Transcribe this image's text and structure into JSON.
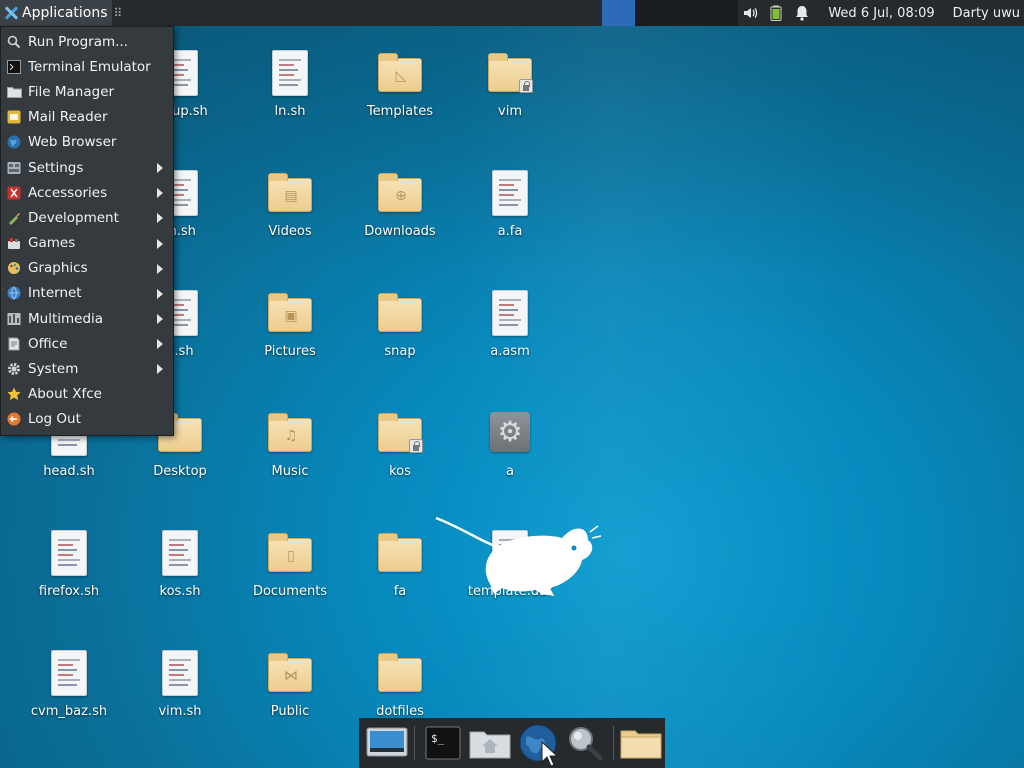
{
  "top_panel": {
    "applications_label": "Applications",
    "clock": "Wed  6 Jul, 08:09",
    "user": "Darty uwu",
    "workspaces": 4,
    "active_workspace": 1
  },
  "app_menu": {
    "items": [
      {
        "label": "Run Program...",
        "icon": "search-icon",
        "submenu": false
      },
      {
        "label": "Terminal Emulator",
        "icon": "terminal-icon",
        "submenu": false
      },
      {
        "label": "File Manager",
        "icon": "folder-icon",
        "submenu": false
      },
      {
        "label": "Mail Reader",
        "icon": "mail-icon",
        "submenu": false
      },
      {
        "label": "Web Browser",
        "icon": "globe-icon",
        "submenu": false
      },
      {
        "label": "Settings",
        "icon": "settings-icon",
        "submenu": true
      },
      {
        "label": "Accessories",
        "icon": "accessories-icon",
        "submenu": true
      },
      {
        "label": "Development",
        "icon": "development-icon",
        "submenu": true
      },
      {
        "label": "Games",
        "icon": "games-icon",
        "submenu": true
      },
      {
        "label": "Graphics",
        "icon": "graphics-icon",
        "submenu": true
      },
      {
        "label": "Internet",
        "icon": "internet-icon",
        "submenu": true
      },
      {
        "label": "Multimedia",
        "icon": "multimedia-icon",
        "submenu": true
      },
      {
        "label": "Office",
        "icon": "office-icon",
        "submenu": true
      },
      {
        "label": "System",
        "icon": "gear-icon",
        "submenu": true
      },
      {
        "label": "About Xfce",
        "icon": "star-icon",
        "submenu": false
      },
      {
        "label": "Log Out",
        "icon": "logout-icon",
        "submenu": false
      }
    ]
  },
  "desktop": {
    "icons": [
      {
        "label": "setup.sh",
        "type": "file"
      },
      {
        "label": "ln.sh",
        "type": "file"
      },
      {
        "label": "Templates",
        "type": "folder",
        "emblem": "template"
      },
      {
        "label": "vim",
        "type": "folder",
        "lock": true
      },
      {
        "label": "m.sh",
        "type": "file"
      },
      {
        "label": "Videos",
        "type": "folder",
        "emblem": "film"
      },
      {
        "label": "Downloads",
        "type": "folder",
        "emblem": "download"
      },
      {
        "label": "a.fa",
        "type": "file"
      },
      {
        "label": "e.sh",
        "type": "file"
      },
      {
        "label": "Pictures",
        "type": "folder",
        "emblem": "picture"
      },
      {
        "label": "snap",
        "type": "folder"
      },
      {
        "label": "a.asm",
        "type": "file"
      },
      {
        "label": "head.sh",
        "type": "file"
      },
      {
        "label": "Desktop",
        "type": "folder"
      },
      {
        "label": "Music",
        "type": "folder",
        "emblem": "music"
      },
      {
        "label": "kos",
        "type": "folder",
        "lock": true
      },
      {
        "label": "a",
        "type": "executable"
      },
      {
        "label": "firefox.sh",
        "type": "file"
      },
      {
        "label": "kos.sh",
        "type": "file"
      },
      {
        "label": "Documents",
        "type": "folder",
        "emblem": "document"
      },
      {
        "label": "fa",
        "type": "folder"
      },
      {
        "label": "template.dat",
        "type": "file"
      },
      {
        "label": "cvm_baz.sh",
        "type": "file"
      },
      {
        "label": "vim.sh",
        "type": "file"
      },
      {
        "label": "Public",
        "type": "folder",
        "emblem": "share"
      },
      {
        "label": "dotfiles",
        "type": "folder"
      }
    ]
  },
  "dock": {
    "items": [
      {
        "name": "show-desktop-icon"
      },
      {
        "name": "terminal-icon"
      },
      {
        "name": "home-folder-icon"
      },
      {
        "name": "web-browser-icon"
      },
      {
        "name": "app-finder-icon"
      },
      {
        "name": "folder-icon"
      }
    ]
  },
  "colors": {
    "panel": "#262a2d",
    "menu": "#353a3e",
    "desktop": "#0a89bd",
    "active_workspace": "#2d6bb8"
  }
}
